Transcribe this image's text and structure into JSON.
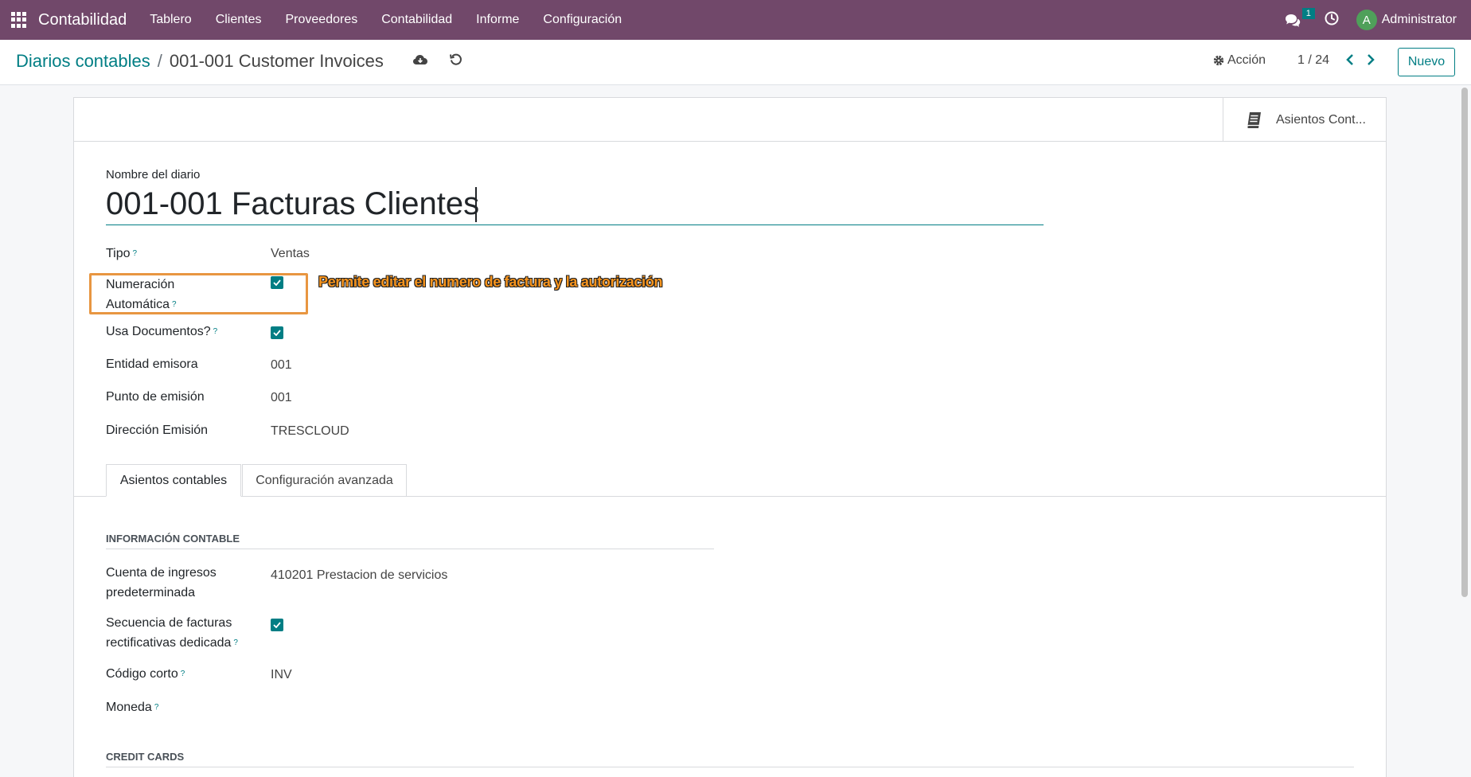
{
  "navbar": {
    "app_name": "Contabilidad",
    "menu": [
      "Tablero",
      "Clientes",
      "Proveedores",
      "Contabilidad",
      "Informe",
      "Configuración"
    ],
    "chat_count": "1",
    "avatar_letter": "A",
    "user_name": "Administrator",
    "bg_color": "#71486a"
  },
  "control": {
    "breadcrumb_parent": "Diarios contables",
    "breadcrumb_separator": "/",
    "breadcrumb_current": "001-001 Customer Invoices",
    "action_label": "Acción",
    "pager": "1 / 24",
    "new_label": "Nuevo"
  },
  "smart_button": {
    "label": "Asientos Cont...",
    "icon": "book-icon"
  },
  "form": {
    "name_caption": "Nombre del diario",
    "name_value": "001-001 Facturas Clientes",
    "fields": {
      "tipo_label": "Tipo",
      "tipo_value": "Ventas",
      "numeracion_label_1": "Numeración",
      "numeracion_label_2": "Automática",
      "numeracion_checked": true,
      "usa_docs_label": "Usa Documentos?",
      "usa_docs_checked": true,
      "entidad_label": "Entidad emisora",
      "entidad_value": "001",
      "punto_label": "Punto de emisión",
      "punto_value": "001",
      "direccion_label": "Dirección Emisión",
      "direccion_value": "TRESCLOUD"
    },
    "help_mark": "?"
  },
  "annotation": {
    "text": "Permite editar el numero de factura y la autorización",
    "color": "#f7941d"
  },
  "tabs": [
    {
      "label": "Asientos contables",
      "active": true
    },
    {
      "label": "Configuración avanzada",
      "active": false
    }
  ],
  "accounting": {
    "section_title": "INFORMACIÓN CONTABLE",
    "income_label_1": "Cuenta de ingresos",
    "income_label_2": "predeterminada",
    "income_value": "410201 Prestacion de servicios",
    "refund_label_1": "Secuencia de facturas",
    "refund_label_2": "rectificativas dedicada",
    "refund_checked": true,
    "code_label": "Código corto",
    "code_value": "INV",
    "currency_label": "Moneda",
    "credit_cards_title": "CREDIT CARDS"
  },
  "colors": {
    "accent": "#017e84",
    "highlight": "#e89641"
  }
}
